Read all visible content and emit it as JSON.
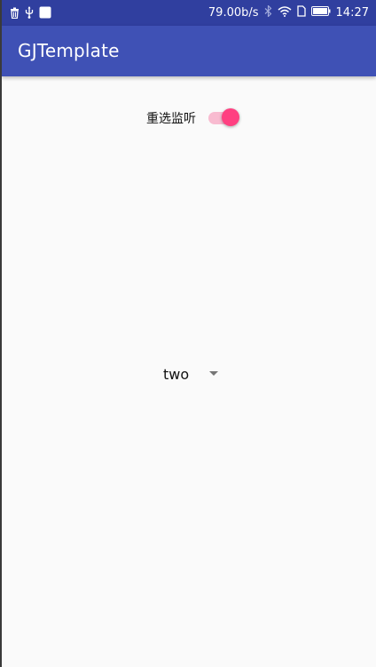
{
  "status_bar": {
    "left_icons": [
      "trash-icon",
      "usb-icon",
      "notification-square-icon"
    ],
    "network_speed": "79.00b/s",
    "right_icons": [
      "bluetooth-icon",
      "wifi-icon",
      "sim-icon",
      "battery-icon"
    ],
    "time": "14:27"
  },
  "app_bar": {
    "title": "GJTemplate",
    "color": "#3f51b5"
  },
  "switch_row": {
    "label": "重选监听",
    "checked": true,
    "accent": "#ff4081"
  },
  "spinner": {
    "selected": "two"
  },
  "colors": {
    "status_bar": "#303f9f",
    "background": "#fafafa"
  }
}
